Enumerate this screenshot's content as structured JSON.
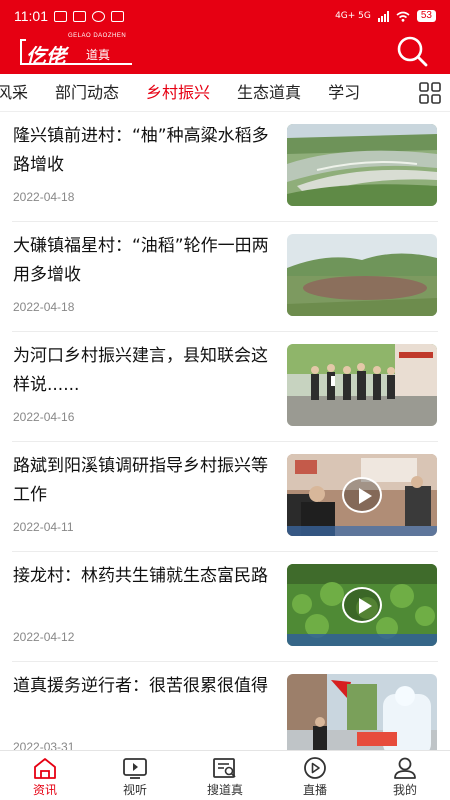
{
  "status_bar": {
    "time": "11:01",
    "network": "4G+ 5G",
    "battery": "53"
  },
  "header": {
    "logo_small": "GELAO DAOZHEN",
    "logo_main": "仡佬",
    "logo_sub": "道真",
    "brand_color": "#e60012"
  },
  "tabs": {
    "items": [
      {
        "label": "风采"
      },
      {
        "label": "部门动态"
      },
      {
        "label": "乡村振兴"
      },
      {
        "label": "生态道真"
      },
      {
        "label": "学习"
      }
    ],
    "active": "乡村振兴",
    "more_icon": "grid-icon"
  },
  "news": [
    {
      "title": "隆兴镇前进村：“柚”种高粱水稻多路增收",
      "date": "2022-04-18",
      "video": false
    },
    {
      "title": "大磏镇福星村：“油稻”轮作一田两用多增收",
      "date": "2022-04-18",
      "video": false
    },
    {
      "title": "为河口乡村振兴建言，县知联会这样说......",
      "date": "2022-04-16",
      "video": false
    },
    {
      "title": "路斌到阳溪镇调研指导乡村振兴等工作",
      "date": "2022-04-11",
      "video": true
    },
    {
      "title": "接龙村：林药共生铺就生态富民路",
      "date": "2022-04-12",
      "video": true
    },
    {
      "title": "道真援务逆行者：很苦很累很值得",
      "date": "2022-03-31",
      "video": false
    }
  ],
  "bottom_nav": [
    {
      "label": "资讯",
      "icon": "home-icon",
      "active": true
    },
    {
      "label": "视听",
      "icon": "tv-icon",
      "active": false
    },
    {
      "label": "搜道真",
      "icon": "search-news-icon",
      "active": false
    },
    {
      "label": "直播",
      "icon": "live-play-icon",
      "active": false
    },
    {
      "label": "我的",
      "icon": "user-icon",
      "active": false
    }
  ]
}
